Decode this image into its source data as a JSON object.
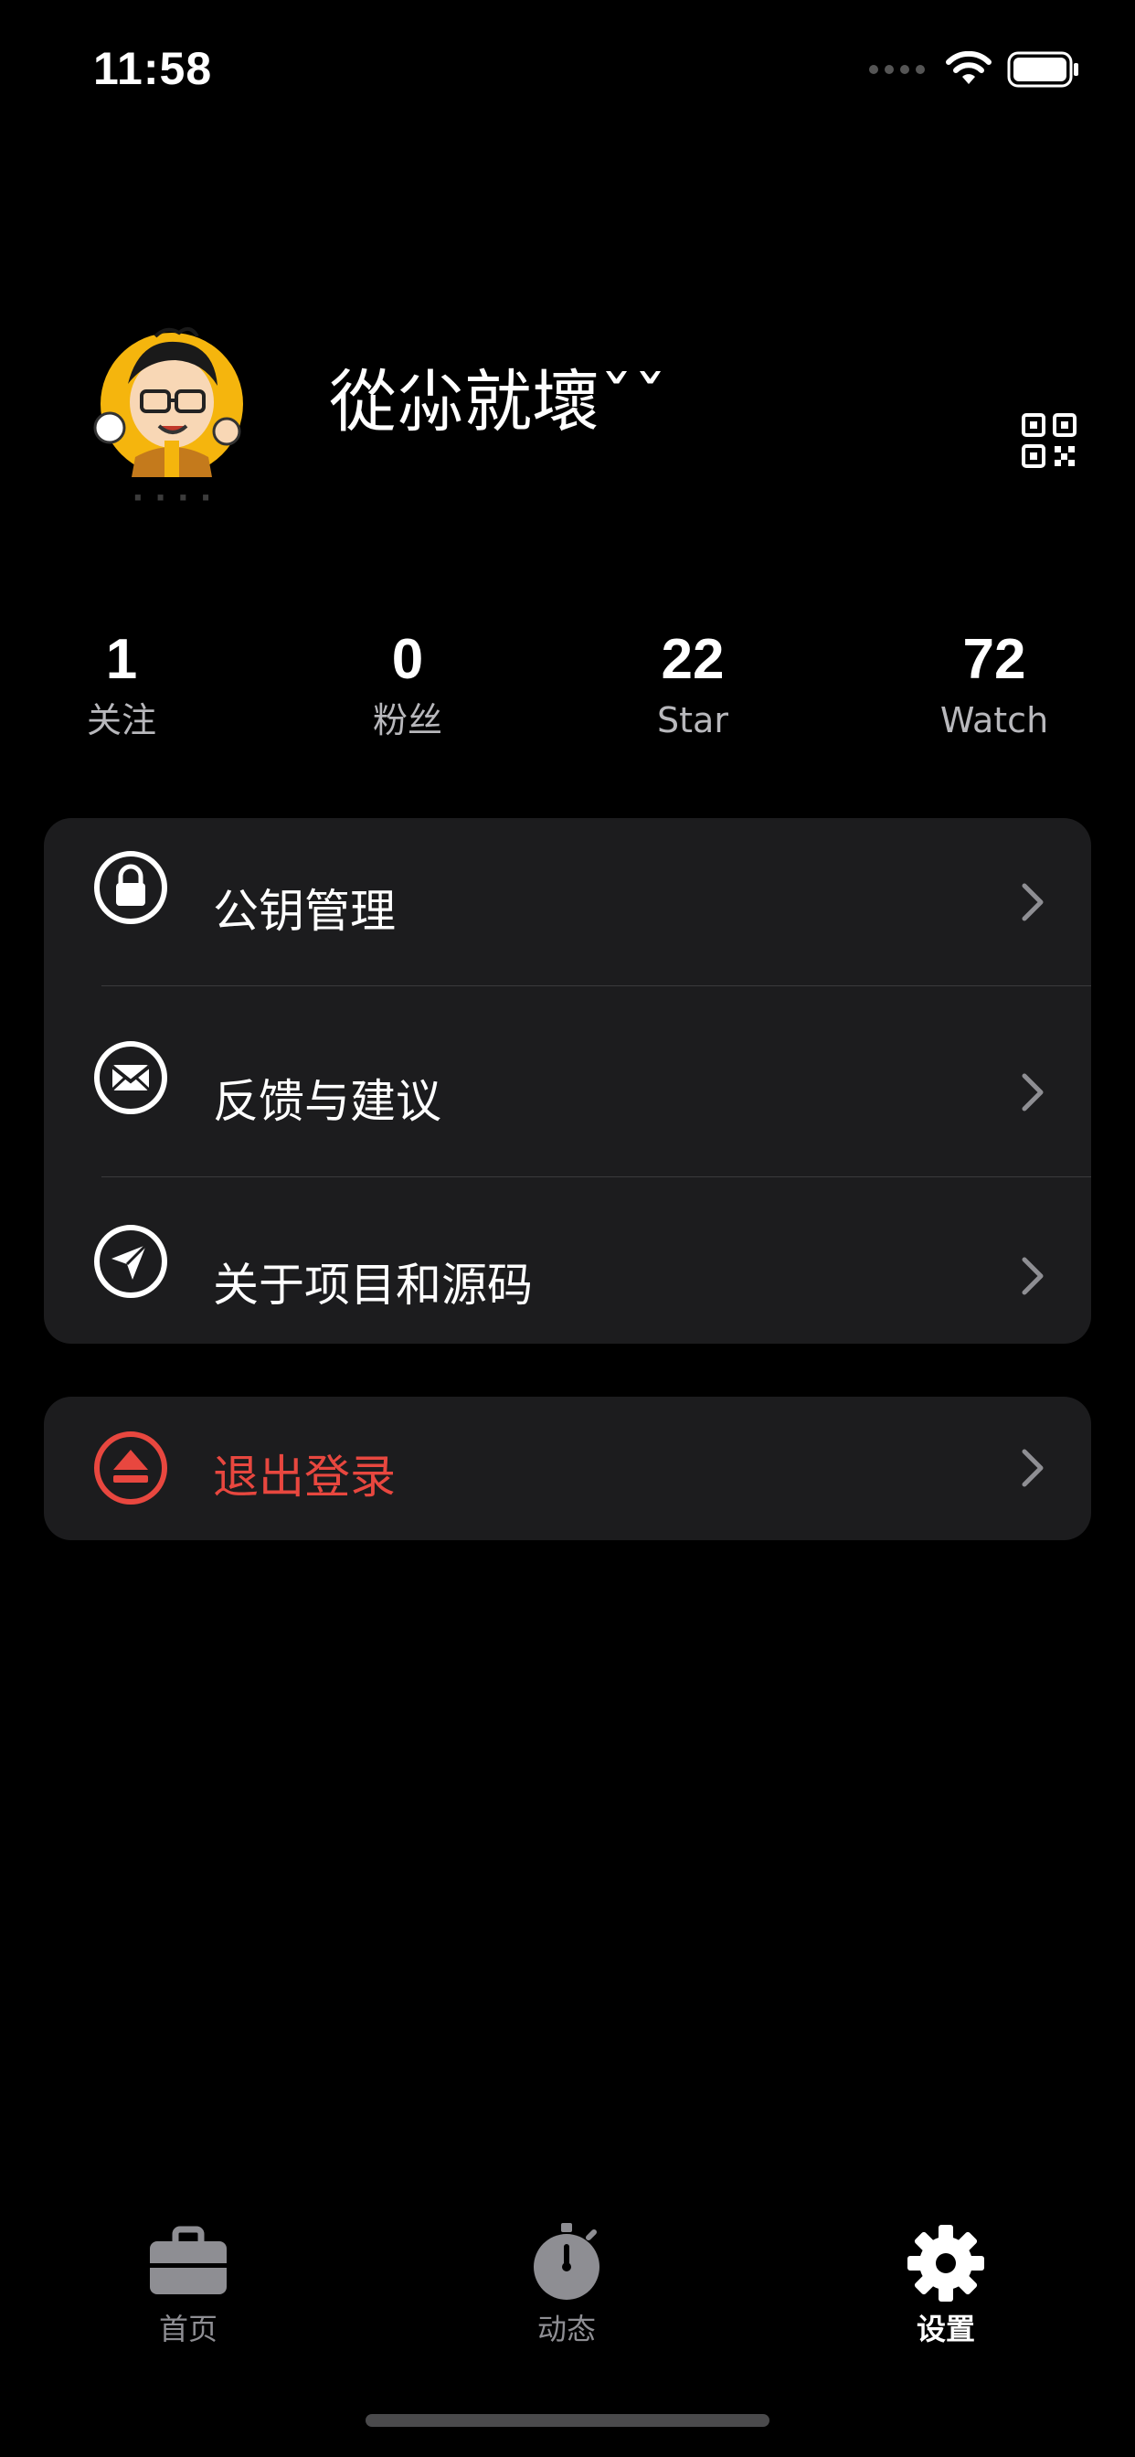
{
  "status_bar": {
    "time": "11:58"
  },
  "profile": {
    "username": "從尛就壞ˇˇ"
  },
  "stats": [
    {
      "value": "1",
      "label": "关注"
    },
    {
      "value": "0",
      "label": "粉丝"
    },
    {
      "value": "22",
      "label": "Star"
    },
    {
      "value": "72",
      "label": "Watch"
    }
  ],
  "settings": {
    "items": [
      {
        "label": "公钥管理",
        "icon": "lock-icon"
      },
      {
        "label": "反馈与建议",
        "icon": "mail-icon"
      },
      {
        "label": "关于项目和源码",
        "icon": "send-icon"
      }
    ]
  },
  "logout": {
    "label": "退出登录",
    "icon": "logout-icon"
  },
  "tabbar": {
    "items": [
      {
        "label": "首页",
        "icon": "briefcase-icon",
        "active": false
      },
      {
        "label": "动态",
        "icon": "stopwatch-icon",
        "active": false
      },
      {
        "label": "设置",
        "icon": "gear-icon",
        "active": true
      }
    ]
  },
  "colors": {
    "background": "#000000",
    "card": "#1c1c1e",
    "danger": "#e8473f",
    "inactive": "#8e8e93",
    "secondary_text": "#b8b8bc"
  }
}
